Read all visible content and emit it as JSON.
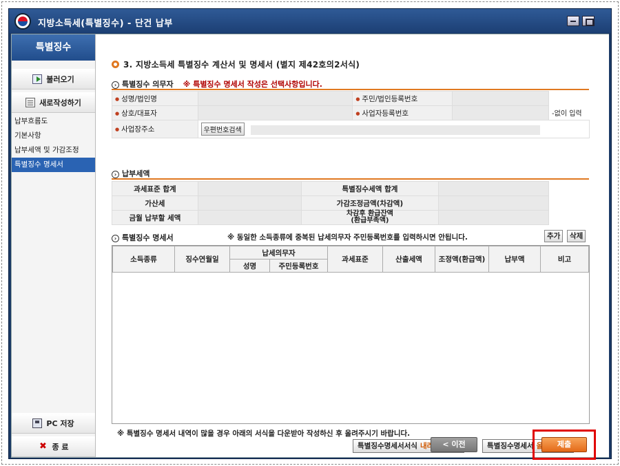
{
  "window": {
    "title": "지방소득세(특별징수) - 단건 납부"
  },
  "sidebar": {
    "header": "특별징수",
    "load_button": "불러오기",
    "new_button": "새로작성하기",
    "menu": [
      {
        "label": "납부흐름도",
        "active": false
      },
      {
        "label": "기본사항",
        "active": false
      },
      {
        "label": "납부세액 및 가감조정",
        "active": false
      },
      {
        "label": "특별징수 명세서",
        "active": true
      }
    ],
    "pc_save_button": "PC 저장",
    "exit_button": "종 료"
  },
  "main": {
    "section_title": "3. 지방소득세 특별징수 계산서 및 명세서 (별지 제42호의2서식)",
    "obligor": {
      "heading": "특별징수 의무자",
      "warning": "※ 특별징수 명세서 작성은 선택사항입니다.",
      "labels": {
        "name": "성명/법인명",
        "resident_no": "주민/법인등록번호",
        "trade_name": "상호/대표자",
        "biz_no": "사업자등록번호",
        "address": "사업장주소"
      },
      "postcode_button": "우편번호검색",
      "side_note": "-없이 입력"
    },
    "tax_amount": {
      "heading": "납부세액",
      "labels": {
        "taxable_total": "과세표준 합계",
        "special_tax_total": "특별징수세액 합계",
        "penalty": "가산세",
        "adjustment": "가감조정금액(차감액)",
        "payable": "금월 납부할 세액",
        "refund_balance_1": "차감후 환급잔액",
        "refund_balance_2": "(환급부족액)"
      }
    },
    "statement": {
      "heading": "특별징수 명세서",
      "notice": "※ 동일한 소득종류에 중복된 납세의무자 주민등록번호를 입력하시면 안됩니다.",
      "add_button": "추가",
      "delete_button": "삭제",
      "columns": {
        "income_type": "소득종류",
        "collection_date": "징수연월일",
        "taxpayer": "납세의무자",
        "taxpayer_name": "성명",
        "taxpayer_rrn": "주민등록번호",
        "tax_base": "과세표준",
        "computed_tax": "산출세액",
        "adjusted_refund": "조정액(환급액)",
        "payment": "납부액",
        "remarks": "비고"
      }
    },
    "bottom_notice": "※ 특별징수 명세서 내역이 많을 경우 아래의 서식을 다운받아 작성하신 후 올려주시기 바랍니다.",
    "download_button": {
      "text": "특별징수명세서서식 ",
      "highlight": "내려받기"
    },
    "upload_button": {
      "text": "특별징수명세서 ",
      "highlight": "올리기"
    }
  },
  "footer": {
    "prev_button": "< 이전",
    "submit_button": "제출"
  }
}
